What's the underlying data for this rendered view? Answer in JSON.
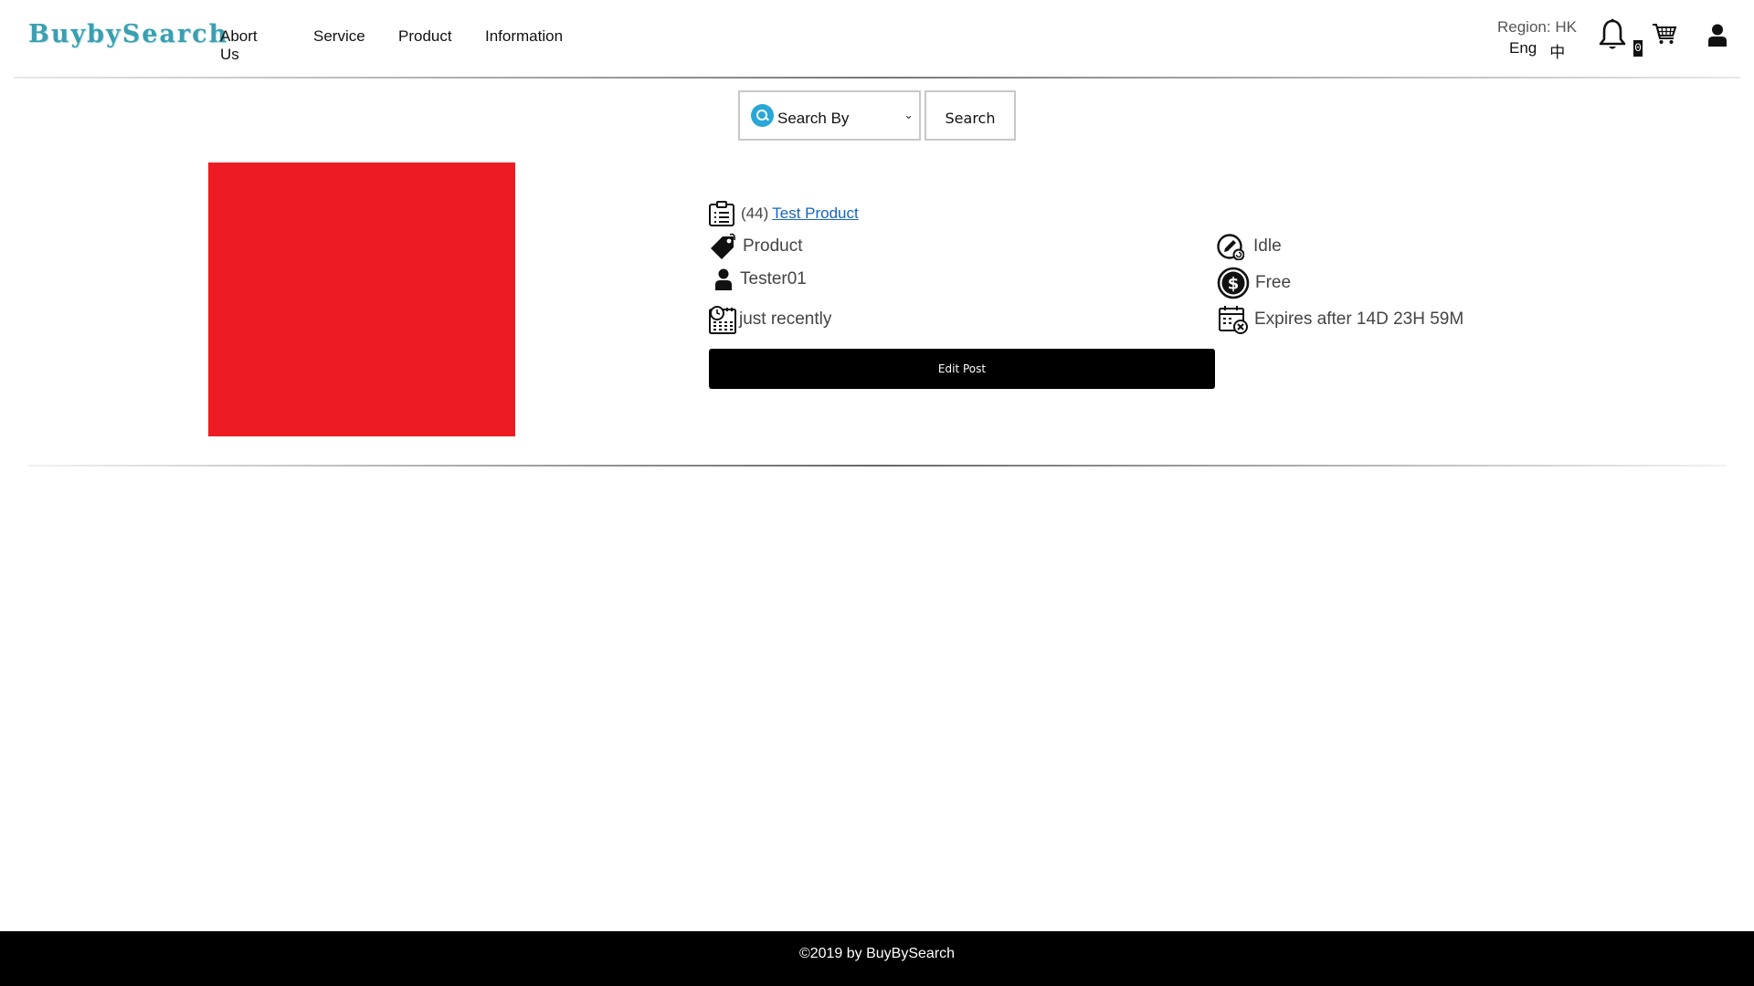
{
  "header": {
    "logo": "BuybySearch",
    "nav": [
      "Abort Us",
      "Service",
      "Product",
      "Information"
    ],
    "region": "Region: HK",
    "lang_en": "Eng",
    "lang_zh": "中",
    "notification_count": "0"
  },
  "search": {
    "select_label": "Search By",
    "button_label": "Search"
  },
  "product": {
    "image_color": "#ed1c24",
    "count": "(44)",
    "title": "Test Product",
    "type": "Product",
    "user": "Tester01",
    "posted": "just recently",
    "status": "Idle",
    "price": "Free",
    "expiry": "Expires after 14D 23H 59M",
    "edit_label": "Edit Post"
  },
  "footer": {
    "copyright": "©2019 by BuyBySearch"
  },
  "colors": {
    "logo": "#3a9fb0",
    "link": "#1565c0",
    "search_icon": "#29a7d6"
  }
}
